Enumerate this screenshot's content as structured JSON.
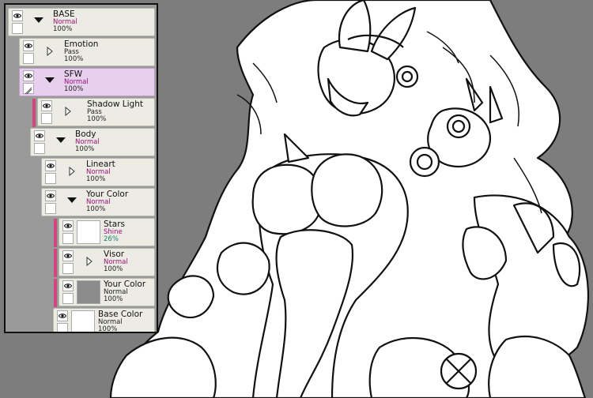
{
  "layers": [
    {
      "name": "BASE",
      "mode": "Normal",
      "opacity": "100%",
      "type": "folder",
      "expanded": true
    },
    {
      "name": "Emotion",
      "mode": "Pass",
      "opacity": "100%",
      "type": "folder",
      "expanded": false
    },
    {
      "name": "SFW",
      "mode": "Normal",
      "opacity": "100%",
      "type": "folder",
      "expanded": true,
      "selected": true
    },
    {
      "name": "Shadow Light",
      "mode": "Pass",
      "opacity": "100%",
      "type": "folder",
      "expanded": false
    },
    {
      "name": "Body",
      "mode": "Normal",
      "opacity": "100%",
      "type": "folder",
      "expanded": true
    },
    {
      "name": "Lineart",
      "mode": "Normal",
      "opacity": "100%",
      "type": "folder",
      "expanded": false
    },
    {
      "name": "Your Color",
      "mode": "Normal",
      "opacity": "100%",
      "type": "folder",
      "expanded": true
    },
    {
      "name": "Stars",
      "mode": "Shine",
      "opacity": "26%",
      "type": "raster"
    },
    {
      "name": "Visor",
      "mode": "Normal",
      "opacity": "100%",
      "type": "folder",
      "expanded": false
    },
    {
      "name": "Your Color",
      "mode": "Normal",
      "opacity": "100%",
      "type": "raster"
    },
    {
      "name": "Base Color",
      "mode": "Normal",
      "opacity": "100%",
      "type": "raster"
    }
  ],
  "colors": {
    "panel_bg": "#9a9a9a",
    "layer_bg": "#ecebe4",
    "selected_bg": "#e6d0ee",
    "clip_stripe": "#d2457e",
    "mode_text": "#9b0f7a",
    "opacity_teal": "#17826f",
    "canvas_bg": "#7d7d7d"
  }
}
